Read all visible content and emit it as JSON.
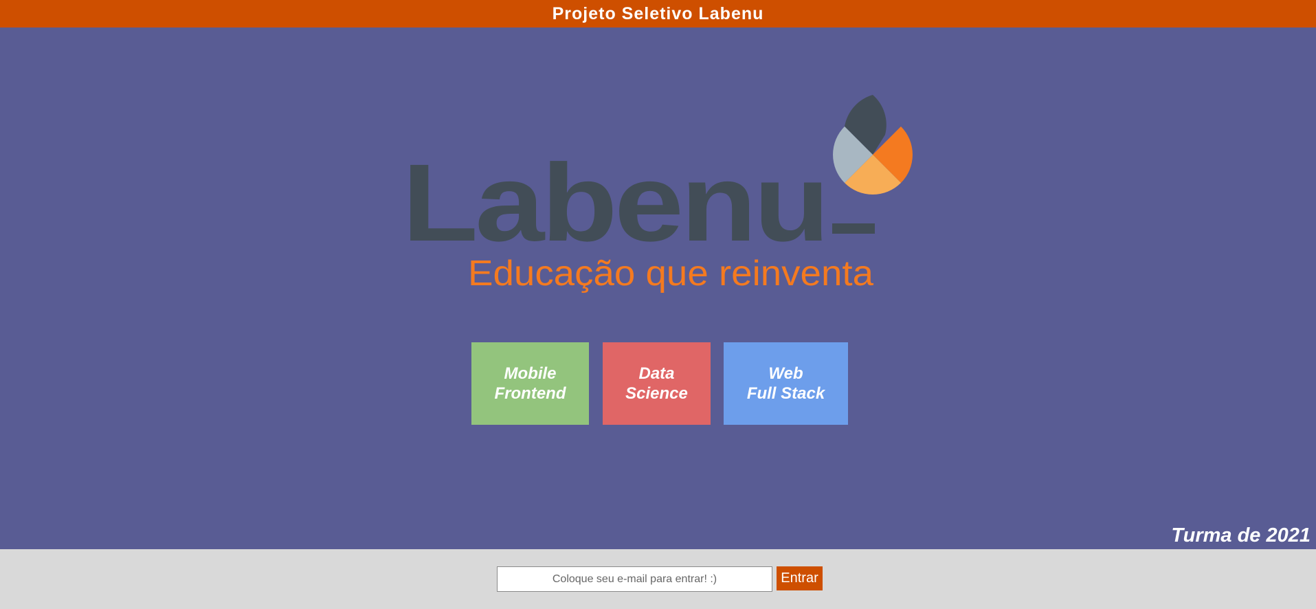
{
  "header": {
    "title": "Projeto Seletivo Labenu"
  },
  "logo": {
    "wordmark": "Labenu",
    "tagline": "Educação que reinventa",
    "colors": {
      "wordmark": "#424d57",
      "tagline": "#f47a20",
      "petal_dark": "#424d57",
      "petal_light": "#a8b7c2",
      "petal_orange": "#f47a20",
      "petal_peach": "#f7ad56"
    }
  },
  "courses": [
    {
      "line1": "Mobile",
      "line2": "Frontend",
      "color": "#93c47d"
    },
    {
      "line1": "Data",
      "line2": "Science",
      "color": "#e06666"
    },
    {
      "line1": "Web",
      "line2": "Full Stack",
      "color": "#6d9eeb"
    }
  ],
  "turma_label": "Turma de 2021",
  "login": {
    "email_value": "",
    "email_placeholder": "Coloque seu e-mail para entrar! :)",
    "submit_label": "Entrar"
  },
  "colors": {
    "header_bg": "#ce4f00",
    "page_bg": "#595c94",
    "footer_bg": "#d9d9d9",
    "button_bg": "#ce4f00"
  }
}
